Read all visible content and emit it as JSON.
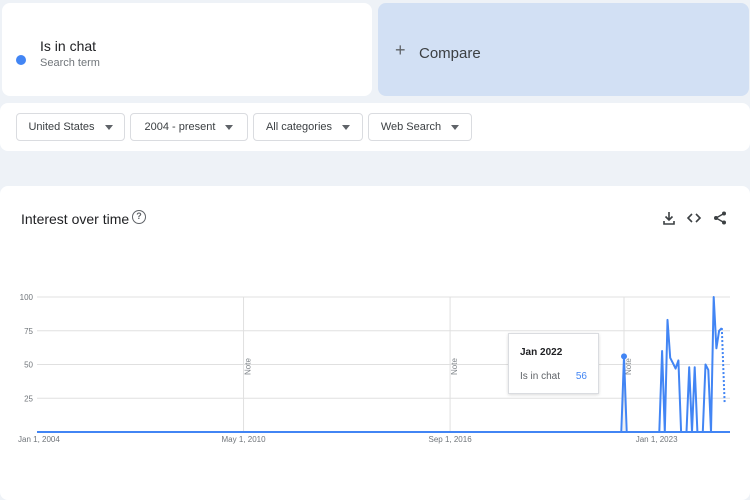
{
  "search_term": {
    "name": "Is in chat",
    "subtitle": "Search term",
    "color": "#4285f4"
  },
  "compare": {
    "label": "Compare"
  },
  "filters": {
    "region": "United States",
    "time_range": "2004 - present",
    "category": "All categories",
    "search_type": "Web Search"
  },
  "chart": {
    "title": "Interest over time",
    "note_label": "Note",
    "accent": "#4285f4",
    "tooltip": {
      "date": "Jan 2022",
      "term": "Is in chat",
      "value": "56"
    }
  },
  "chart_data": {
    "type": "line",
    "x_tick_labels": [
      "Jan 1, 2004",
      "May 1, 2010",
      "Sep 1, 2016",
      "Jan 1, 2023"
    ],
    "y_tick_labels": [
      "100",
      "75",
      "50",
      "25"
    ],
    "ylim": [
      0,
      100
    ],
    "grid": true,
    "notes_at": [
      "2010-05",
      "2016-09",
      "2022-01"
    ],
    "series": [
      {
        "name": "Is in chat",
        "points": [
          [
            "2004-01",
            0
          ],
          [
            "2021-12",
            0
          ],
          [
            "2022-01",
            56
          ],
          [
            "2022-02",
            0
          ],
          [
            "2022-12",
            0
          ],
          [
            "2023-01",
            0
          ],
          [
            "2023-02",
            0
          ],
          [
            "2023-03",
            60
          ],
          [
            "2023-04",
            0
          ],
          [
            "2023-05",
            83
          ],
          [
            "2023-06",
            55
          ],
          [
            "2023-07",
            51
          ],
          [
            "2023-08",
            47
          ],
          [
            "2023-09",
            53
          ],
          [
            "2023-10",
            0
          ],
          [
            "2023-11",
            0
          ],
          [
            "2023-12",
            0
          ],
          [
            "2024-01",
            48
          ],
          [
            "2024-02",
            0
          ],
          [
            "2024-03",
            48
          ],
          [
            "2024-04",
            0
          ],
          [
            "2024-05",
            0
          ],
          [
            "2024-06",
            0
          ],
          [
            "2024-07",
            50
          ],
          [
            "2024-08",
            46
          ],
          [
            "2024-09",
            0
          ],
          [
            "2024-10",
            100
          ],
          [
            "2024-11",
            62
          ],
          [
            "2024-12",
            75
          ],
          [
            "2025-01",
            77
          ]
        ],
        "partial_points": [
          [
            "2025-01",
            77
          ],
          [
            "2025-02",
            22
          ]
        ]
      }
    ]
  }
}
